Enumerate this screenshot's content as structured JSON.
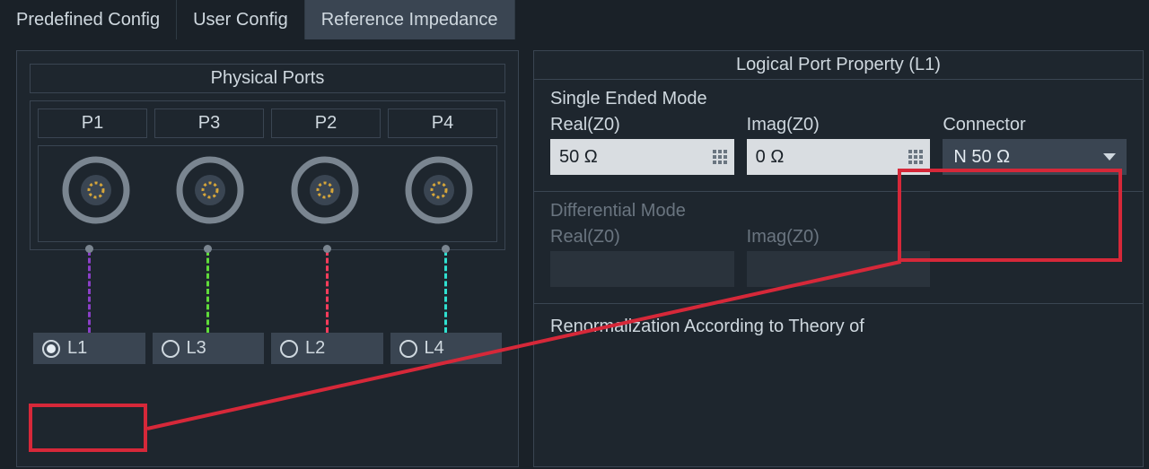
{
  "tabs": {
    "predefined": "Predefined Config",
    "user": "User Config",
    "reference": "Reference Impedance"
  },
  "left": {
    "title": "Physical Ports",
    "ports": [
      "P1",
      "P3",
      "P2",
      "P4"
    ],
    "line_colors": [
      "#8a3fc7",
      "#5fdc3a",
      "#ff3b5b",
      "#2fe0d0"
    ],
    "logical": [
      "L1",
      "L3",
      "L2",
      "L4"
    ],
    "selected_logical": "L1"
  },
  "right": {
    "title": "Logical Port Property (L1)",
    "single_label": "Single Ended Mode",
    "diff_label": "Differential Mode",
    "real_label": "Real(Z0)",
    "imag_label": "Imag(Z0)",
    "connector_label": "Connector",
    "real_value": "50 Ω",
    "imag_value": "0 Ω",
    "connector_value": "N 50 Ω",
    "renorm_label": "Renormalization According to Theory of"
  }
}
